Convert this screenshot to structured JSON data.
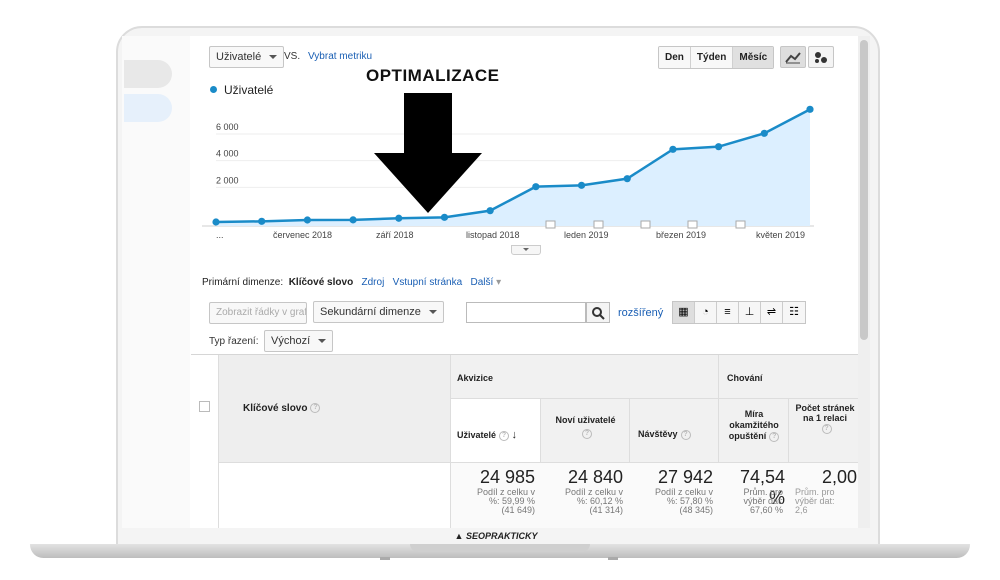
{
  "toolbar": {
    "metric_dropdown": "Uživatelé",
    "vs_label": "VS.",
    "select_metric_link": "Vybrat metriku",
    "annotation_title": "OPTIMALIZACE",
    "periods": [
      "Den",
      "Týden",
      "Měsíc"
    ],
    "active_period": "Měsíc"
  },
  "legend": {
    "series_name": "Uživatelé",
    "color": "#1a8bc8"
  },
  "chart_data": {
    "type": "area",
    "series": [
      {
        "name": "Uživatelé",
        "values": [
          150,
          200,
          300,
          310,
          430,
          500,
          1000,
          2800,
          2900,
          3400,
          5600,
          5800,
          6800,
          8600
        ]
      }
    ],
    "y_ticks": [
      "6 000",
      "4 000",
      "2 000"
    ],
    "ylim": [
      0,
      9000
    ],
    "x_tick_labels": [
      "...",
      "červenec 2018",
      "září 2018",
      "listopad 2018",
      "leden 2019",
      "březen 2019",
      "květen 2019"
    ],
    "grid": true,
    "fill_color": "#dcefff",
    "line_color": "#1a8bc8"
  },
  "dimensions": {
    "label": "Primární dimenze:",
    "active": "Klíčové slovo",
    "links": [
      "Zdroj",
      "Vstupní stránka"
    ],
    "more": "Další"
  },
  "controls": {
    "plot_rows_button": "Zobrazit řádky v grafu",
    "secondary_dimension": "Sekundární dimenze",
    "search_placeholder": "",
    "advanced_link": "rozšířený",
    "sort_label": "Typ řazení:",
    "sort_value": "Výchozí"
  },
  "table": {
    "group_acquisition": "Akvizice",
    "group_behavior": "Chování",
    "dimension_header": "Klíčové slovo",
    "columns": [
      {
        "label": "Uživatelé",
        "value": "24 985",
        "sub1": "Podíl z celku v",
        "sub2": "%: 59,99 %",
        "sub3": "(41 649)"
      },
      {
        "label": "Noví uživatelé",
        "value": "24 840",
        "sub1": "Podíl z celku v",
        "sub2": "%: 60,12 %",
        "sub3": "(41 314)"
      },
      {
        "label": "Návštěvy",
        "value": "27 942",
        "sub1": "Podíl z celku v",
        "sub2": "%: 57,80 %",
        "sub3": "(48 345)"
      },
      {
        "label": "Míra okamžitého opuštění",
        "value": "74,54 %",
        "sub1": "Prům. pro",
        "sub2": "výběr dat:",
        "sub3": "67,60 %"
      },
      {
        "label": "Počet stránek na 1 relaci",
        "value": "2,00",
        "sub1": "Prům. pro",
        "sub2": "výběr dat:",
        "sub3": "2,6"
      }
    ]
  },
  "brand": "SEOPRAKTICKY"
}
